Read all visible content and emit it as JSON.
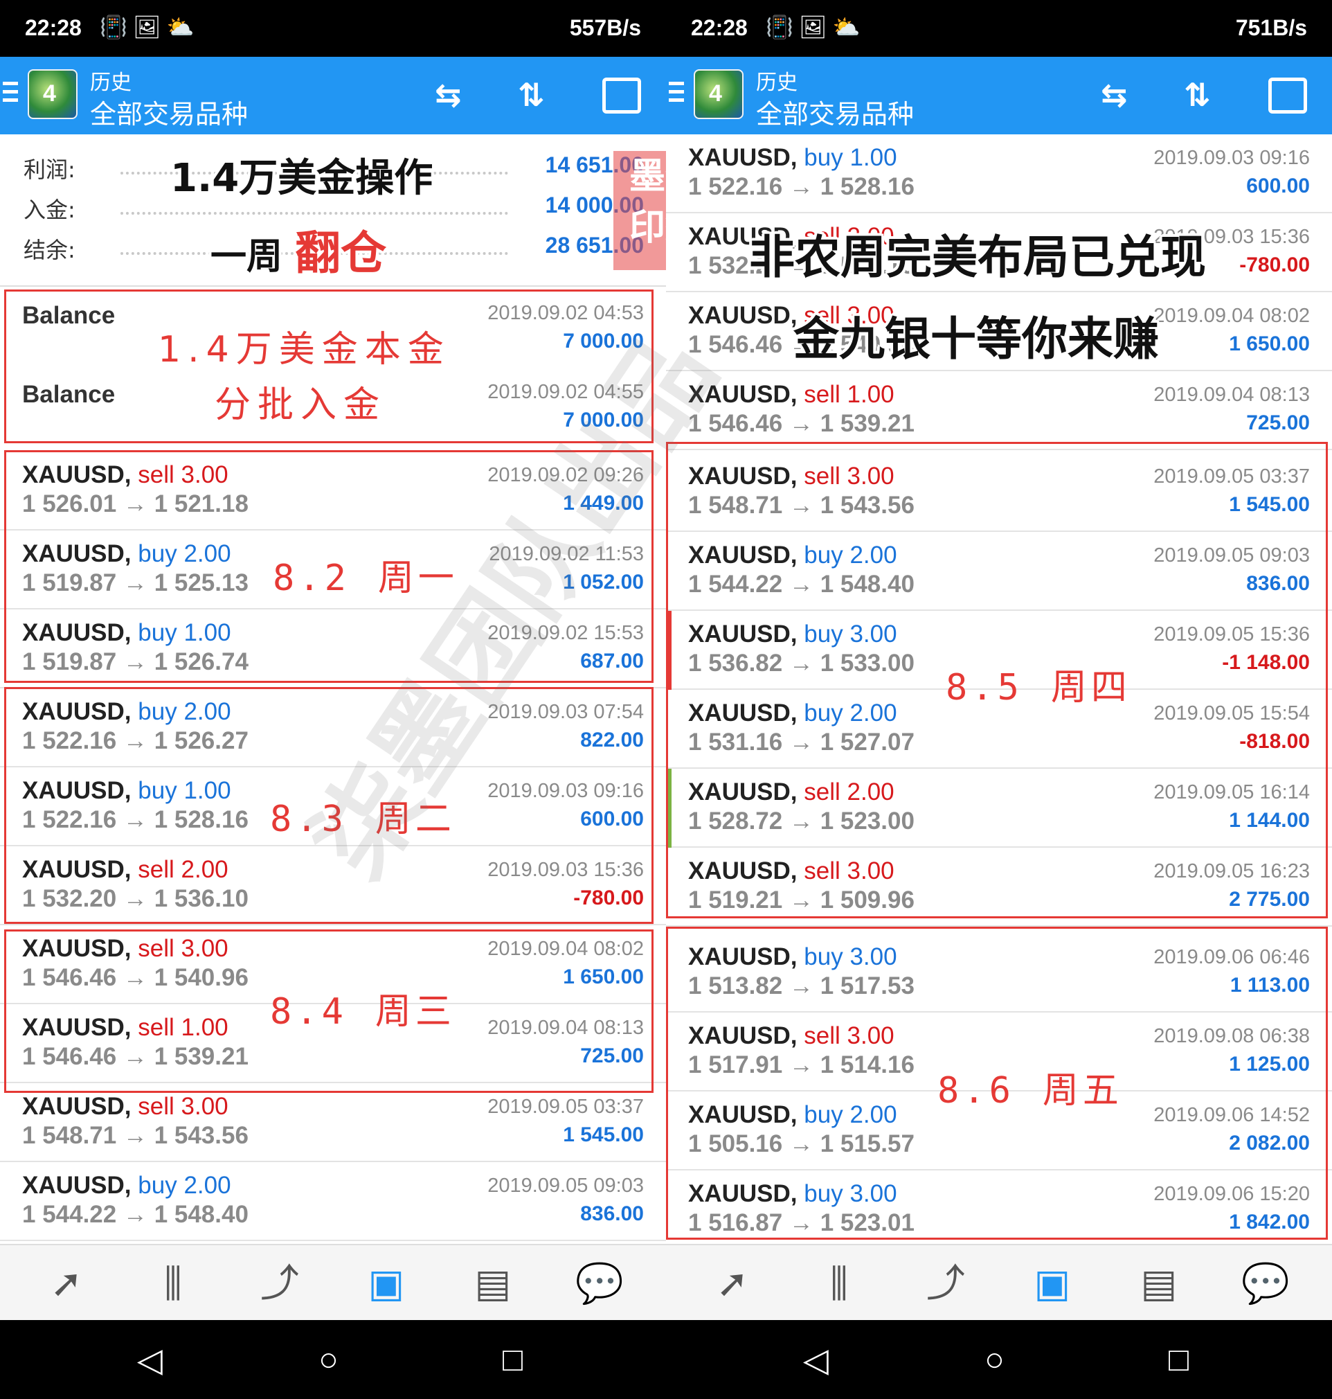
{
  "left": {
    "status": {
      "time": "22:28",
      "icons": "📳🖼⛅",
      "speed": "557B/s"
    },
    "appbar": {
      "title": "历史",
      "subtitle": "全部交易品种",
      "logo": "4"
    },
    "summary": [
      {
        "label": "利润:",
        "value": "14 651.00"
      },
      {
        "label": "入金:",
        "value": "14 000.00"
      },
      {
        "label": "结余:",
        "value": "28 651.00"
      }
    ],
    "balances": [
      {
        "label": "Balance",
        "time": "2019.09.02 04:53",
        "profit": "7 000.00"
      },
      {
        "label": "Balance",
        "time": "2019.09.02 04:55",
        "profit": "7 000.00"
      }
    ],
    "trades": [
      {
        "symbol": "XAUUSD,",
        "side": "sell",
        "lots": "3.00",
        "prices": "1 526.01 → 1 521.18",
        "time": "2019.09.02 09:26",
        "profit": "1 449.00"
      },
      {
        "symbol": "XAUUSD,",
        "side": "buy",
        "lots": "2.00",
        "prices": "1 519.87 → 1 525.13",
        "time": "2019.09.02 11:53",
        "profit": "1 052.00"
      },
      {
        "symbol": "XAUUSD,",
        "side": "buy",
        "lots": "1.00",
        "prices": "1 519.87 → 1 526.74",
        "time": "2019.09.02 15:53",
        "profit": "687.00"
      },
      {
        "symbol": "XAUUSD,",
        "side": "buy",
        "lots": "2.00",
        "prices": "1 522.16 → 1 526.27",
        "time": "2019.09.03 07:54",
        "profit": "822.00"
      },
      {
        "symbol": "XAUUSD,",
        "side": "buy",
        "lots": "1.00",
        "prices": "1 522.16 → 1 528.16",
        "time": "2019.09.03 09:16",
        "profit": "600.00"
      },
      {
        "symbol": "XAUUSD,",
        "side": "sell",
        "lots": "2.00",
        "prices": "1 532.20 → 1 536.10",
        "time": "2019.09.03 15:36",
        "profit": "-780.00"
      },
      {
        "symbol": "XAUUSD,",
        "side": "sell",
        "lots": "3.00",
        "prices": "1 546.46 → 1 540.96",
        "time": "2019.09.04 08:02",
        "profit": "1 650.00"
      },
      {
        "symbol": "XAUUSD,",
        "side": "sell",
        "lots": "1.00",
        "prices": "1 546.46 → 1 539.21",
        "time": "2019.09.04 08:13",
        "profit": "725.00"
      },
      {
        "symbol": "XAUUSD,",
        "side": "sell",
        "lots": "3.00",
        "prices": "1 548.71 → 1 543.56",
        "time": "2019.09.05 03:37",
        "profit": "1 545.00"
      },
      {
        "symbol": "XAUUSD,",
        "side": "buy",
        "lots": "2.00",
        "prices": "1 544.22 → 1 548.40",
        "time": "2019.09.05 09:03",
        "profit": "836.00"
      }
    ],
    "annotations": {
      "headline1": "1.4万美金操作",
      "headline2a": "一周",
      "headline2b": "翻仓",
      "capital_note": "1.4万美金本金",
      "deposit_note": "分批入金",
      "day1_date": "8.2",
      "day1_name": "周一",
      "day2_date": "8.3",
      "day2_name": "周二",
      "day3_date": "8.4",
      "day3_name": "周三",
      "stamp1": "墨李",
      "stamp2": "印桀"
    }
  },
  "right": {
    "status": {
      "time": "22:28",
      "icons": "📳🖼⛅",
      "speed": "751B/s"
    },
    "appbar": {
      "title": "历史",
      "subtitle": "全部交易品种",
      "logo": "4"
    },
    "trades": [
      {
        "symbol": "XAUUSD,",
        "side": "buy",
        "lots": "1.00",
        "prices": "1 522.16 → 1 528.16",
        "time": "2019.09.03 09:16",
        "profit": "600.00"
      },
      {
        "symbol": "XAUUSD,",
        "side": "sell",
        "lots": "2.00",
        "prices": "1 532.20 → 1 536.10",
        "time": "2019.09.03 15:36",
        "profit": "-780.00"
      },
      {
        "symbol": "XAUUSD,",
        "side": "sell",
        "lots": "3.00",
        "prices": "1 546.46 → 1 540.96",
        "time": "2019.09.04 08:02",
        "profit": "1 650.00"
      },
      {
        "symbol": "XAUUSD,",
        "side": "sell",
        "lots": "1.00",
        "prices": "1 546.46 → 1 539.21",
        "time": "2019.09.04 08:13",
        "profit": "725.00"
      },
      {
        "symbol": "XAUUSD,",
        "side": "sell",
        "lots": "3.00",
        "prices": "1 548.71 → 1 543.56",
        "time": "2019.09.05 03:37",
        "profit": "1 545.00"
      },
      {
        "symbol": "XAUUSD,",
        "side": "buy",
        "lots": "2.00",
        "prices": "1 544.22 → 1 548.40",
        "time": "2019.09.05 09:03",
        "profit": "836.00"
      },
      {
        "symbol": "XAUUSD,",
        "side": "buy",
        "lots": "3.00",
        "prices": "1 536.82 → 1 533.00",
        "time": "2019.09.05 15:36",
        "profit": "-1 148.00",
        "marker": "#e53935"
      },
      {
        "symbol": "XAUUSD,",
        "side": "buy",
        "lots": "2.00",
        "prices": "1 531.16 → 1 527.07",
        "time": "2019.09.05 15:54",
        "profit": "-818.00"
      },
      {
        "symbol": "XAUUSD,",
        "side": "sell",
        "lots": "2.00",
        "prices": "1 528.72 → 1 523.00",
        "time": "2019.09.05 16:14",
        "profit": "1 144.00",
        "marker": "#7cb342"
      },
      {
        "symbol": "XAUUSD,",
        "side": "sell",
        "lots": "3.00",
        "prices": "1 519.21 → 1 509.96",
        "time": "2019.09.05 16:23",
        "profit": "2 775.00"
      },
      {
        "symbol": "XAUUSD,",
        "side": "buy",
        "lots": "3.00",
        "prices": "1 513.82 → 1 517.53",
        "time": "2019.09.06 06:46",
        "profit": "1 113.00"
      },
      {
        "symbol": "XAUUSD,",
        "side": "sell",
        "lots": "3.00",
        "prices": "1 517.91 → 1 514.16",
        "time": "2019.09.08 06:38",
        "profit": "1 125.00"
      },
      {
        "symbol": "XAUUSD,",
        "side": "buy",
        "lots": "2.00",
        "prices": "1 505.16 → 1 515.57",
        "time": "2019.09.06 14:52",
        "profit": "2 082.00"
      },
      {
        "symbol": "XAUUSD,",
        "side": "buy",
        "lots": "3.00",
        "prices": "1 516.87 → 1 523.01",
        "time": "2019.09.06 15:20",
        "profit": "1 842.00"
      }
    ],
    "annotations": {
      "headline1": "非农周完美布局已兑现",
      "headline2": "金九银十等你来赚",
      "day4_date": "8.5",
      "day4_name": "周四",
      "day5_date": "8.6",
      "day5_name": "周五"
    }
  },
  "nav": {
    "items": [
      {
        "name": "trade",
        "glyph": "➚"
      },
      {
        "name": "quotes-chart",
        "glyph": "⫼"
      },
      {
        "name": "chart",
        "glyph": "⤴"
      },
      {
        "name": "history",
        "glyph": "▣"
      },
      {
        "name": "news",
        "glyph": "▤"
      },
      {
        "name": "chat",
        "glyph": "💬"
      }
    ]
  },
  "system": {
    "back": "◁",
    "home": "○",
    "recents": "□"
  },
  "watermark": "柒墨团队出品",
  "colors": {
    "accent": "#2296f3",
    "buy": "#1a73d9",
    "sell": "#d7191c",
    "box": "#e53935"
  }
}
